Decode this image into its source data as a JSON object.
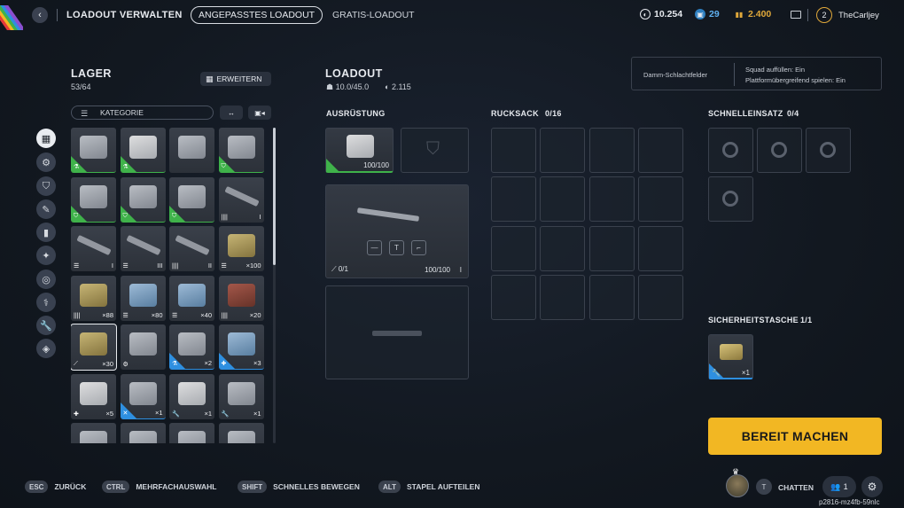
{
  "header": {
    "back_label": "‹",
    "title": "LOADOUT VERWALTEN",
    "tab_active": "ANGEPASSTES LOADOUT",
    "tab_other": "GRATIS-LOADOUT",
    "currency_1": "10.254",
    "currency_2": "29",
    "currency_3": "2.400",
    "level": "2",
    "username": "TheCarljey"
  },
  "storage": {
    "title": "LAGER",
    "count": "53/64",
    "expand_label": "ERWEITERN",
    "category_label": "KATEGORIE",
    "items": [
      {
        "name": "backpack-item",
        "rarity": "green",
        "style": "",
        "qty": "",
        "ticon": "⚗"
      },
      {
        "name": "backpack-item",
        "rarity": "green",
        "style": "white",
        "qty": "",
        "ticon": "⚗"
      },
      {
        "name": "ammo-case-item",
        "rarity": "none",
        "style": "",
        "qty": "",
        "ticon": ""
      },
      {
        "name": "shield-item",
        "rarity": "green",
        "style": "",
        "qty": "",
        "ticon": "⛉"
      },
      {
        "name": "shield-item",
        "rarity": "green",
        "style": "",
        "qty": "",
        "ticon": "⛉"
      },
      {
        "name": "shield-item",
        "rarity": "green",
        "style": "",
        "qty": "",
        "ticon": "⛉"
      },
      {
        "name": "shield-item",
        "rarity": "green",
        "style": "",
        "qty": "",
        "ticon": "⛉"
      },
      {
        "name": "rifle-item",
        "rarity": "none",
        "style": "gun",
        "qty": "I",
        "ticon": "||||"
      },
      {
        "name": "rifle-item",
        "rarity": "none",
        "style": "gun",
        "qty": "I",
        "ticon": "☰"
      },
      {
        "name": "rifle-item",
        "rarity": "none",
        "style": "gun",
        "qty": "III",
        "ticon": "☰"
      },
      {
        "name": "pistol-item",
        "rarity": "none",
        "style": "gun",
        "qty": "II",
        "ticon": "||||"
      },
      {
        "name": "ammo-box-item",
        "rarity": "none",
        "style": "box",
        "qty": "×100",
        "ticon": "☰"
      },
      {
        "name": "ammo-box-item",
        "rarity": "none",
        "style": "box",
        "qty": "×88",
        "ticon": "||||"
      },
      {
        "name": "ammo-box-item",
        "rarity": "none",
        "style": "blue",
        "qty": "×80",
        "ticon": "☰"
      },
      {
        "name": "ammo-box-item",
        "rarity": "none",
        "style": "blue",
        "qty": "×40",
        "ticon": "☰"
      },
      {
        "name": "crate-item",
        "rarity": "none",
        "style": "red",
        "qty": "×20",
        "ticon": "||||"
      },
      {
        "name": "med-kit-item",
        "rarity": "none",
        "style": "box",
        "qty": "×30",
        "ticon": "⟋"
      },
      {
        "name": "binoculars-item",
        "rarity": "none",
        "style": "",
        "qty": "",
        "ticon": "⚙"
      },
      {
        "name": "grenade-item",
        "rarity": "blue",
        "style": "",
        "qty": "×2",
        "ticon": "⚗"
      },
      {
        "name": "bandage-item",
        "rarity": "blue",
        "style": "blue",
        "qty": "×3",
        "ticon": "✚"
      },
      {
        "name": "bandage-roll-item",
        "rarity": "none",
        "style": "white",
        "qty": "×5",
        "ticon": "✚"
      },
      {
        "name": "syringe-item",
        "rarity": "blue",
        "style": "",
        "qty": "×1",
        "ticon": "✕"
      },
      {
        "name": "toolbox-item",
        "rarity": "none",
        "style": "white",
        "qty": "×1",
        "ticon": "🔧"
      },
      {
        "name": "plate-item",
        "rarity": "none",
        "style": "",
        "qty": "×1",
        "ticon": "🔧"
      },
      {
        "name": "tool-item",
        "rarity": "blue",
        "style": "",
        "qty": "",
        "ticon": ""
      },
      {
        "name": "cable-item",
        "rarity": "none",
        "style": "",
        "qty": "",
        "ticon": ""
      },
      {
        "name": "case-item",
        "rarity": "none",
        "style": "",
        "qty": "",
        "ticon": ""
      },
      {
        "name": "case-item",
        "rarity": "none",
        "style": "",
        "qty": "",
        "ticon": ""
      }
    ]
  },
  "loadout": {
    "title": "LOADOUT",
    "weight": "10.0/45.0",
    "value": "2.115",
    "equipment_label": "AUSRÜSTUNG",
    "backpack_durability": "100/100",
    "weapon_ammo": "0/1",
    "weapon_durability": "100/100",
    "backpack_label": "RUCKSACK",
    "backpack_count": "0/16",
    "quick_label": "SCHNELLEINSATZ",
    "quick_count": "0/4",
    "safe_label": "SICHERHEITSTASCHE",
    "safe_count": "1/1",
    "safe_qty": "×1"
  },
  "settings": {
    "map": "Damm-Schlachtfelder",
    "squad_fill": "Squad auffüllen: Ein",
    "crossplay": "Plattformübergreifend spielen: Ein"
  },
  "ready_button": "BEREIT MACHEN",
  "footer": {
    "hints": [
      {
        "key": "ESC",
        "label": "ZURÜCK"
      },
      {
        "key": "CTRL",
        "label": "MEHRFACHAUSWAHL"
      },
      {
        "key": "SHIFT",
        "label": "SCHNELLES BEWEGEN"
      },
      {
        "key": "ALT",
        "label": "STAPEL AUFTEILEN"
      }
    ],
    "chat_key": "T",
    "chat_label": "CHATTEN",
    "friends_count": "1",
    "build_id": "p2816-mz4fb-59nlc"
  },
  "colors": {
    "accent": "#f2b723",
    "rarity_green": "#3fb24a",
    "rarity_blue": "#2e8fe0"
  }
}
